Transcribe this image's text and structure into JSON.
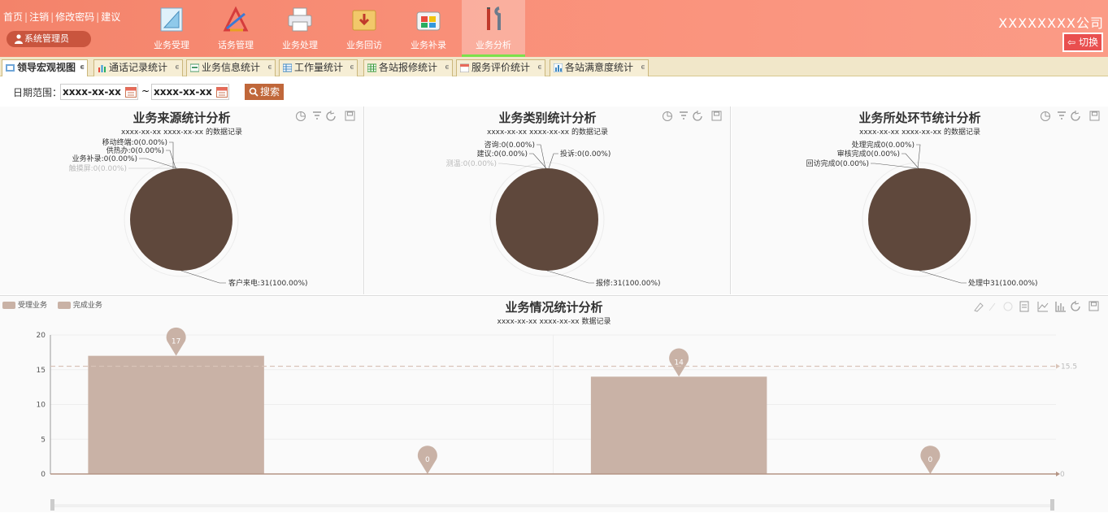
{
  "header": {
    "links": [
      "首页",
      "注销",
      "修改密码",
      "建议"
    ],
    "user": "系统管理员",
    "company": "XXXXXXXX公司",
    "switch_label": "切换",
    "nav": [
      {
        "label": "业务受理",
        "icon": "ruler-triangle-icon"
      },
      {
        "label": "话务管理",
        "icon": "drafting-tools-icon"
      },
      {
        "label": "业务处理",
        "icon": "printer-icon"
      },
      {
        "label": "业务回访",
        "icon": "folder-download-icon"
      },
      {
        "label": "业务补录",
        "icon": "colored-box-icon"
      },
      {
        "label": "业务分析",
        "icon": "wrench-screwdriver-icon",
        "active": true
      }
    ]
  },
  "tabs": [
    {
      "label": "领导宏观视图",
      "active": true
    },
    {
      "label": "通话记录统计"
    },
    {
      "label": "业务信息统计"
    },
    {
      "label": "工作量统计"
    },
    {
      "label": "各站报修统计"
    },
    {
      "label": "服务评价统计"
    },
    {
      "label": "各站满意度统计"
    }
  ],
  "toolbar": {
    "date_label": "日期范围：",
    "start_date": "xxxx-xx-xx",
    "end_date": "xxxx-xx-xx",
    "separator": "~",
    "search_label": "搜索"
  },
  "panels": [
    {
      "title": "业务来源统计分析",
      "subtitle": "xxxx-xx-xx   xxxx-xx-xx  的数据记录",
      "zero_labels": [
        "移动终端:0(0.00%)",
        "供热办:0(0.00%)",
        "业务补录:0(0.00%)",
        "触摸屏:0(0.00%)"
      ],
      "main_label": "客户来电:31(100.00%)"
    },
    {
      "title": "业务类别统计分析",
      "subtitle": "xxxx-xx-xx   xxxx-xx-xx  的数据记录",
      "zero_labels": [
        "咨询:0(0.00%)",
        "建议:0(0.00%)",
        "投诉:0(0.00%)",
        "测温:0(0.00%)"
      ],
      "main_label": "报修:31(100.00%)"
    },
    {
      "title": "业务所处环节统计分析",
      "subtitle": "xxxx-xx-xx   xxxx-xx-xx  的数据记录",
      "zero_labels": [
        "处理完成0(0.00%)",
        "审核完成0(0.00%)",
        "回访完成0(0.00%)"
      ],
      "main_label": "处理中31(100.00%)"
    }
  ],
  "chart_data": {
    "type": "bar",
    "title": "业务情况统计分析",
    "subtitle": "xxxx-xx-xx   xxxx-xx-xx  数据记录",
    "categories": [
      "",
      ""
    ],
    "series": [
      {
        "name": "受理业务",
        "values": [
          17,
          14
        ]
      },
      {
        "name": "完成业务",
        "values": [
          0,
          0
        ]
      }
    ],
    "ylim": [
      0,
      20
    ],
    "yticks": [
      0,
      5,
      10,
      15,
      20
    ],
    "markline": {
      "value": 15.5,
      "label": "15.5"
    },
    "markline_zero_label": "0",
    "colors": {
      "bar": "#c9b2a6",
      "pin": "#c9b2a6"
    },
    "legend": "top-left"
  },
  "colors": {
    "header": "#f98f78",
    "pie": "#5f483c",
    "accent": "#c0673a"
  }
}
